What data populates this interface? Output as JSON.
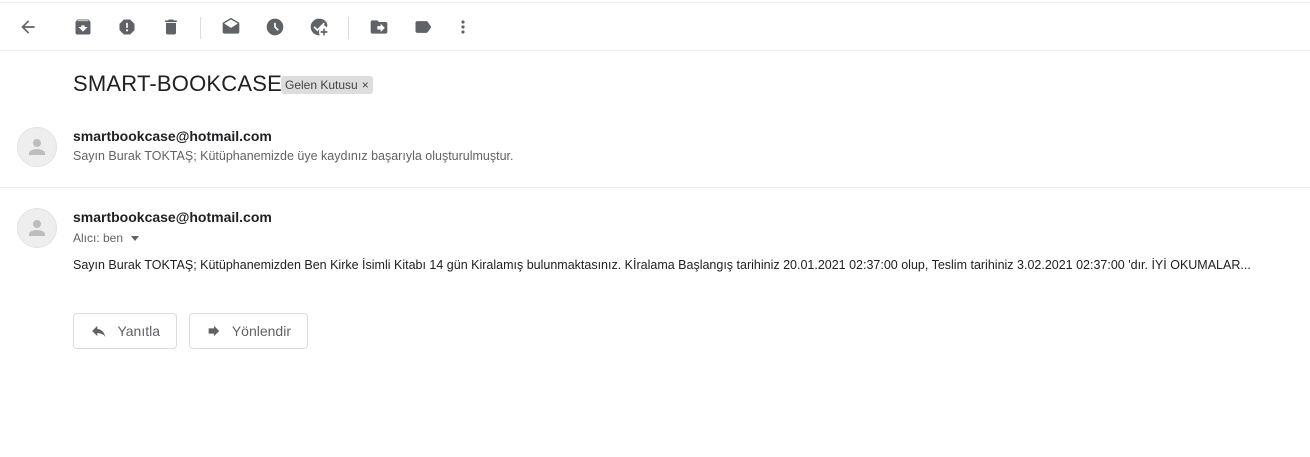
{
  "toolbar": {
    "icons": [
      "back-arrow-icon",
      "archive-icon",
      "report-spam-icon",
      "delete-icon",
      "mark-unread-icon",
      "snooze-icon",
      "add-to-tasks-icon",
      "move-to-icon",
      "labels-icon",
      "more-vert-icon"
    ]
  },
  "thread": {
    "subject": "SMART-BOOKCASE",
    "label": "Gelen Kutusu",
    "label_remove": "×"
  },
  "messages": [
    {
      "sender": "smartbookcase@hotmail.com",
      "snippet": "Sayın Burak TOKTAŞ; Kütüphanemizde üye kaydınız başarıyla oluşturulmuştur."
    },
    {
      "sender": "smartbookcase@hotmail.com",
      "to": "Alıcı: ben",
      "body": "Sayın Burak TOKTAŞ; Kütüphanemizden Ben Kirke İsimli Kitabı 14 gün Kiralamış bulunmaktasınız. Kİralama Başlangış tarihiniz 20.01.2021 02:37:00 olup, Teslim tarihiniz 3.02.2021 02:37:00 'dır. İYİ OKUMALAR..."
    }
  ],
  "actions": {
    "reply": "Yanıtla",
    "forward": "Yönlendir"
  }
}
